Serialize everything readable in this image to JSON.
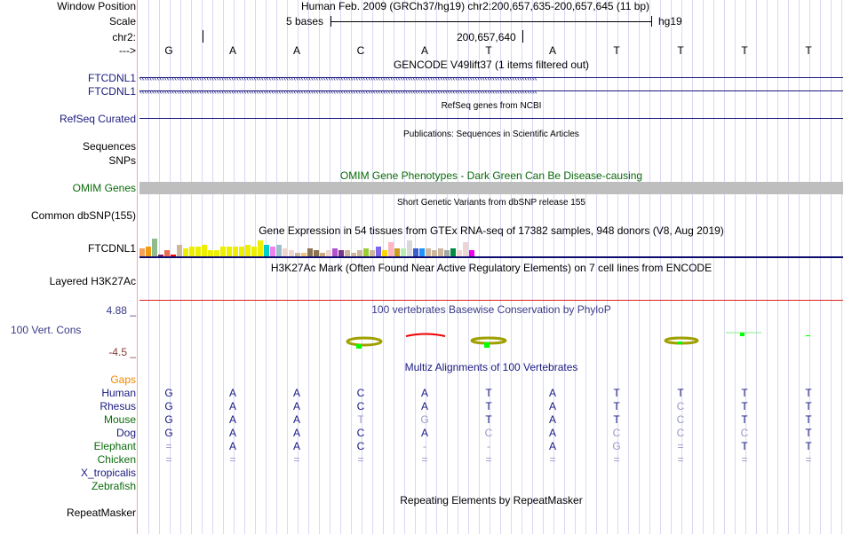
{
  "labels": {
    "window_position": "Window Position",
    "scale": "Scale",
    "chrom": "chr2:",
    "strand": "--->",
    "gencode1": "FTCDNL1",
    "gencode2": "FTCDNL1",
    "refseq": "RefSeq Curated",
    "sequences": "Sequences",
    "snps": "SNPs",
    "omim": "OMIM Genes",
    "dbsnp": "Common dbSNP(155)",
    "gtex": "FTCDNL1",
    "h3k27ac": "Layered H3K27Ac",
    "cons_max": "4.88 _",
    "cons": "100 Vert. Cons",
    "cons_min": "-4.5 _",
    "gaps": "Gaps",
    "repeatmasker": "RepeatMasker"
  },
  "header": {
    "assembly": "Human Feb. 2009 (GRCh37/hg19)   chr2:200,657,635-200,657,645 (11 bp)",
    "scale_label": "5 bases",
    "scale_db": "hg19",
    "position_tick": "200,657,640"
  },
  "bases": [
    "G",
    "A",
    "A",
    "C",
    "A",
    "T",
    "A",
    "T",
    "T",
    "T",
    "T"
  ],
  "titles": {
    "gencode": "GENCODE V49lift37 (1 items filtered out)",
    "refseq": "RefSeq genes from NCBI",
    "publications": "Publications: Sequences in Scientific Articles",
    "omim": "OMIM Gene Phenotypes - Dark Green Can Be Disease-causing",
    "snp": "Short Genetic Variants from dbSNP release 155",
    "gtex": "Gene Expression in 54 tissues from GTEx RNA-seq of 17382 samples, 948 donors (V8, Aug 2019)",
    "h3k27ac": "H3K27Ac Mark (Often Found Near Active Regulatory Elements) on 7 cell lines from ENCODE",
    "phylop": "100 vertebrates Basewise Conservation by PhyloP",
    "multiz": "Multiz Alignments of 100 Vertebrates",
    "repeat": "Repeating Elements by RepeatMasker"
  },
  "gtex_bars": {
    "values": [
      4,
      5,
      9,
      1,
      3,
      1,
      6,
      4,
      5,
      5,
      6,
      3,
      3,
      5,
      5,
      5,
      5,
      6,
      5,
      8,
      6,
      5,
      6,
      4,
      3,
      2,
      2,
      4,
      3,
      2,
      3,
      4,
      3,
      3,
      2,
      3,
      4,
      3,
      5,
      3,
      7,
      4,
      4,
      8,
      4,
      4,
      4,
      3,
      4,
      3,
      4,
      3,
      7,
      3
    ],
    "colors": [
      "#f4a259",
      "#f09b12",
      "#8fbc8f",
      "#8b1c62",
      "#ee6a50",
      "#ff0000",
      "#cdb79e",
      "#eeee00",
      "#eeee00",
      "#eeee00",
      "#eeee00",
      "#eeee00",
      "#eeee00",
      "#eeee00",
      "#eeee00",
      "#eeee00",
      "#eeee00",
      "#eeee00",
      "#eeee00",
      "#eeee00",
      "#00cdcd",
      "#ee82ee",
      "#9ac0cd",
      "#eed5d2",
      "#eed5d2",
      "#cdb79e",
      "#f4c27a",
      "#8b7355",
      "#8b7355",
      "#cdaa7d",
      "#eed5d2",
      "#b452cd",
      "#7a378b",
      "#cdb79e",
      "#cdb79e",
      "#cdb79e",
      "#9acd32",
      "#cdb79e",
      "#7b68ee",
      "#ffd700",
      "#ffb6c1",
      "#cd9b1d",
      "#b4eeb4",
      "#d9d9d9",
      "#3a5fcd",
      "#1e90ff",
      "#cdb79e",
      "#cdb79e",
      "#cdb79e",
      "#a6a6a6",
      "#008b45",
      "#eed5d2",
      "#eed5d2",
      "#ee00ee"
    ]
  },
  "multiz": {
    "species": [
      {
        "name": "Human",
        "color": "#1a1a80",
        "bases": [
          "G",
          "A",
          "A",
          "C",
          "A",
          "T",
          "A",
          "T",
          "T",
          "T",
          "T"
        ],
        "dim": []
      },
      {
        "name": "Rhesus",
        "color": "#1a1a80",
        "bases": [
          "G",
          "A",
          "A",
          "C",
          "A",
          "T",
          "A",
          "T",
          "C",
          "T",
          "T"
        ],
        "dim": [
          8
        ]
      },
      {
        "name": "Mouse",
        "color": "#0a6b0a",
        "bases": [
          "G",
          "A",
          "A",
          "T",
          "G",
          "T",
          "A",
          "T",
          "C",
          "T",
          "T"
        ],
        "dim": [
          3,
          4,
          8
        ]
      },
      {
        "name": "Dog",
        "color": "#1a1a80",
        "bases": [
          "G",
          "A",
          "A",
          "C",
          "A",
          "C",
          "A",
          "C",
          "C",
          "C",
          "T"
        ],
        "dim": [
          5,
          7,
          8,
          9
        ]
      },
      {
        "name": "Elephant",
        "color": "#0a6b0a",
        "bases": [
          "=",
          "A",
          "A",
          "C",
          "-",
          "-",
          "A",
          "G",
          "=",
          "T",
          "T"
        ],
        "dim": [
          0,
          4,
          5,
          7,
          8
        ]
      },
      {
        "name": "Chicken",
        "color": "#0a6b0a",
        "bases": [
          "=",
          "=",
          "=",
          "=",
          "=",
          "=",
          "=",
          "=",
          "=",
          "=",
          "="
        ],
        "dim": [
          0,
          1,
          2,
          3,
          4,
          5,
          6,
          7,
          8,
          9,
          10
        ]
      },
      {
        "name": "X_tropicalis",
        "color": "#1a1a80",
        "bases": [],
        "dim": []
      },
      {
        "name": "Zebrafish",
        "color": "#0a6b0a",
        "bases": [],
        "dim": []
      }
    ]
  }
}
